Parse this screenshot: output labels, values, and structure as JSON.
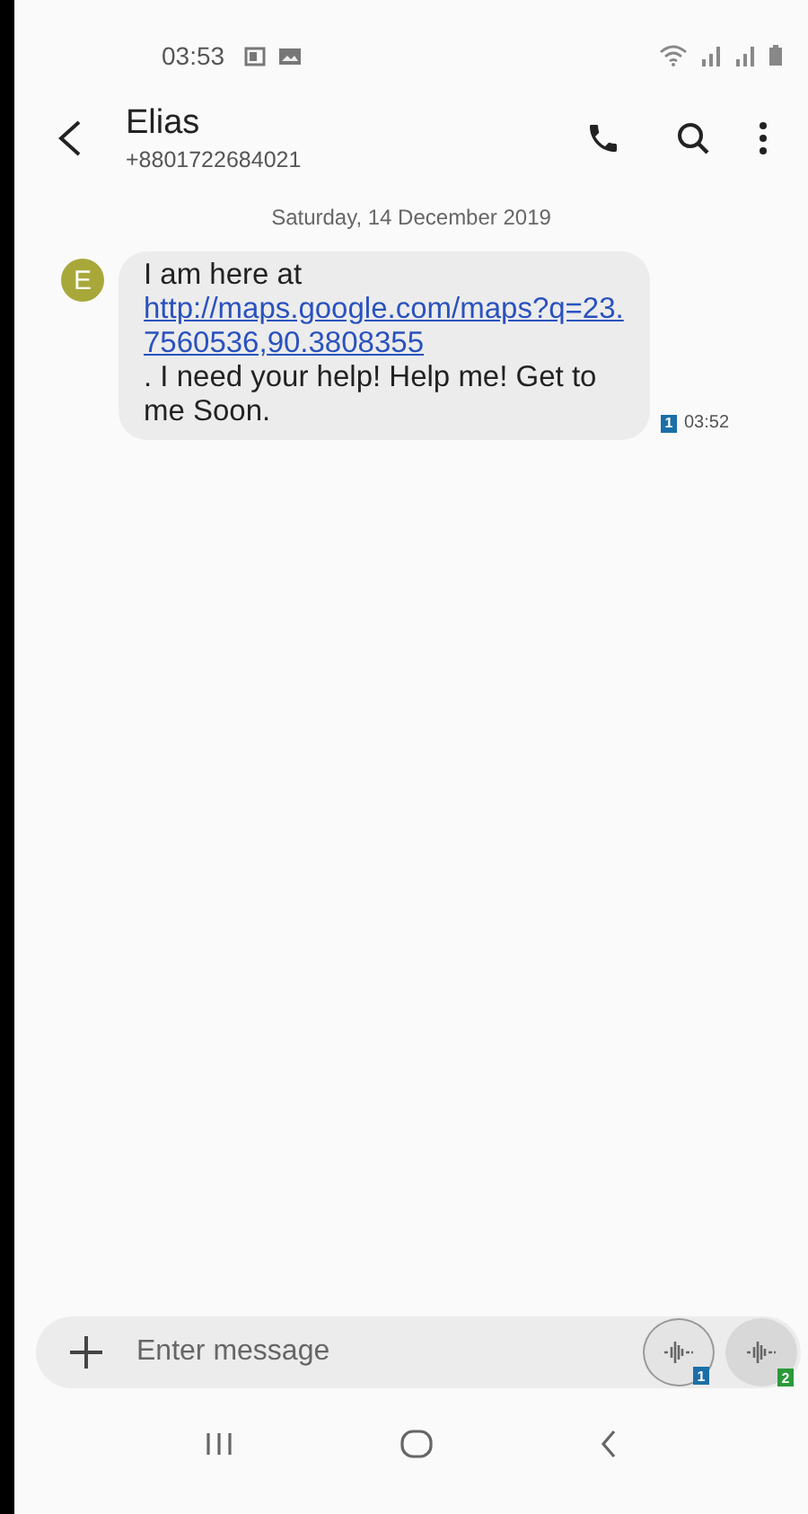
{
  "status_bar": {
    "time": "03:53"
  },
  "header": {
    "name": "Elias",
    "number": "+8801722684021"
  },
  "date_divider": "Saturday, 14 December 2019",
  "messages": [
    {
      "avatar_letter": "E",
      "text_before": "I am here at ",
      "link": "http://maps.google.com/maps?q=23.7560536,90.3808355",
      "text_after": ". I need your help! Help me! Get to me Soon.",
      "sim": "1",
      "time": "03:52"
    }
  ],
  "composer": {
    "placeholder": "Enter message",
    "send_buttons": [
      {
        "sim": "1",
        "color": "#1a6fa8",
        "selected": true
      },
      {
        "sim": "2",
        "color": "#2a9a3a",
        "selected": false
      }
    ]
  }
}
